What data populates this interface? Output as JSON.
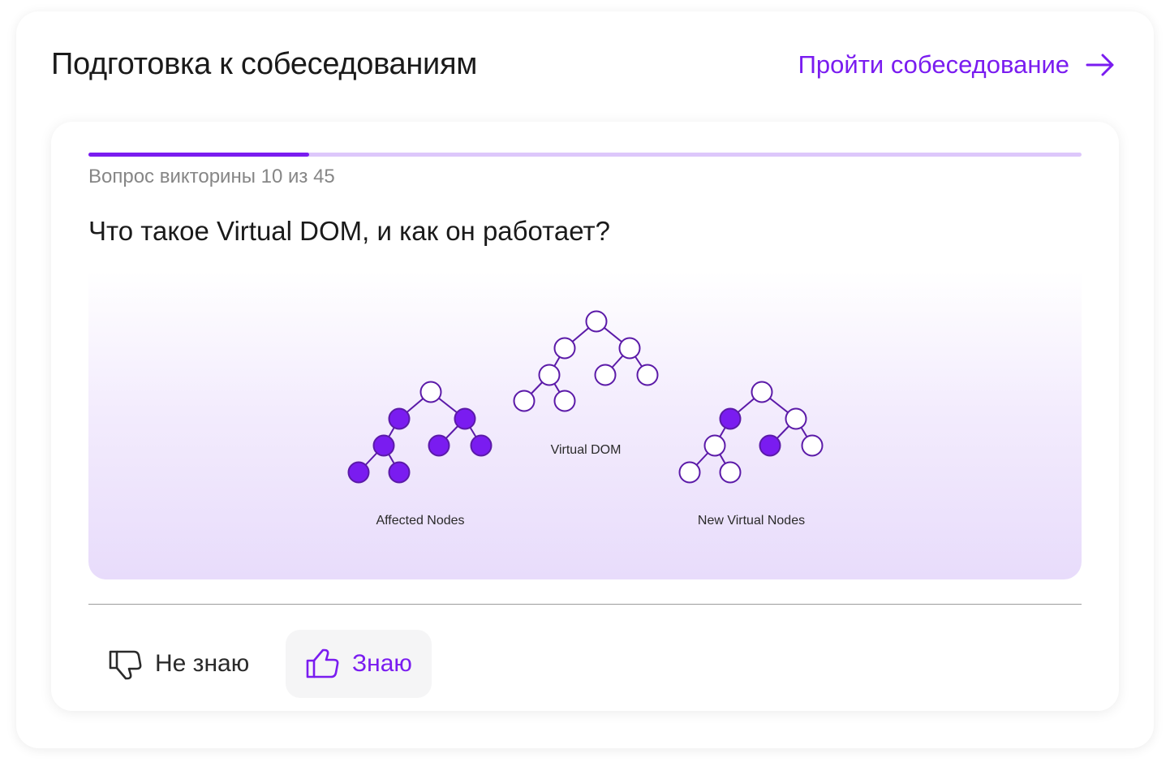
{
  "header": {
    "title": "Подготовка к собеседованиям",
    "link_label": "Пройти собеседование",
    "link_icon": "arrow-right-icon"
  },
  "quiz": {
    "progress": {
      "current": 10,
      "total": 45
    },
    "counter_text": "Вопрос викторины 10 из 45",
    "question": "Что такое Virtual DOM, и как он работает?"
  },
  "illustration": {
    "labels": {
      "virtual_dom": "Virtual DOM",
      "affected": "Affected Nodes",
      "new_virtual": "New Virtual Nodes"
    },
    "colors": {
      "node_stroke": "#5b1aa8",
      "node_fill_active": "#7a1cf0",
      "node_fill_empty": "#ffffff"
    }
  },
  "actions": {
    "dont_know": {
      "label": "Не знаю",
      "icon": "thumbs-down-icon"
    },
    "know": {
      "label": "Знаю",
      "icon": "thumbs-up-icon"
    }
  },
  "colors": {
    "accent": "#7a1cf0",
    "progress_track": "#ddc7fb",
    "text_primary": "#1a1a1a",
    "text_secondary": "#868686"
  }
}
